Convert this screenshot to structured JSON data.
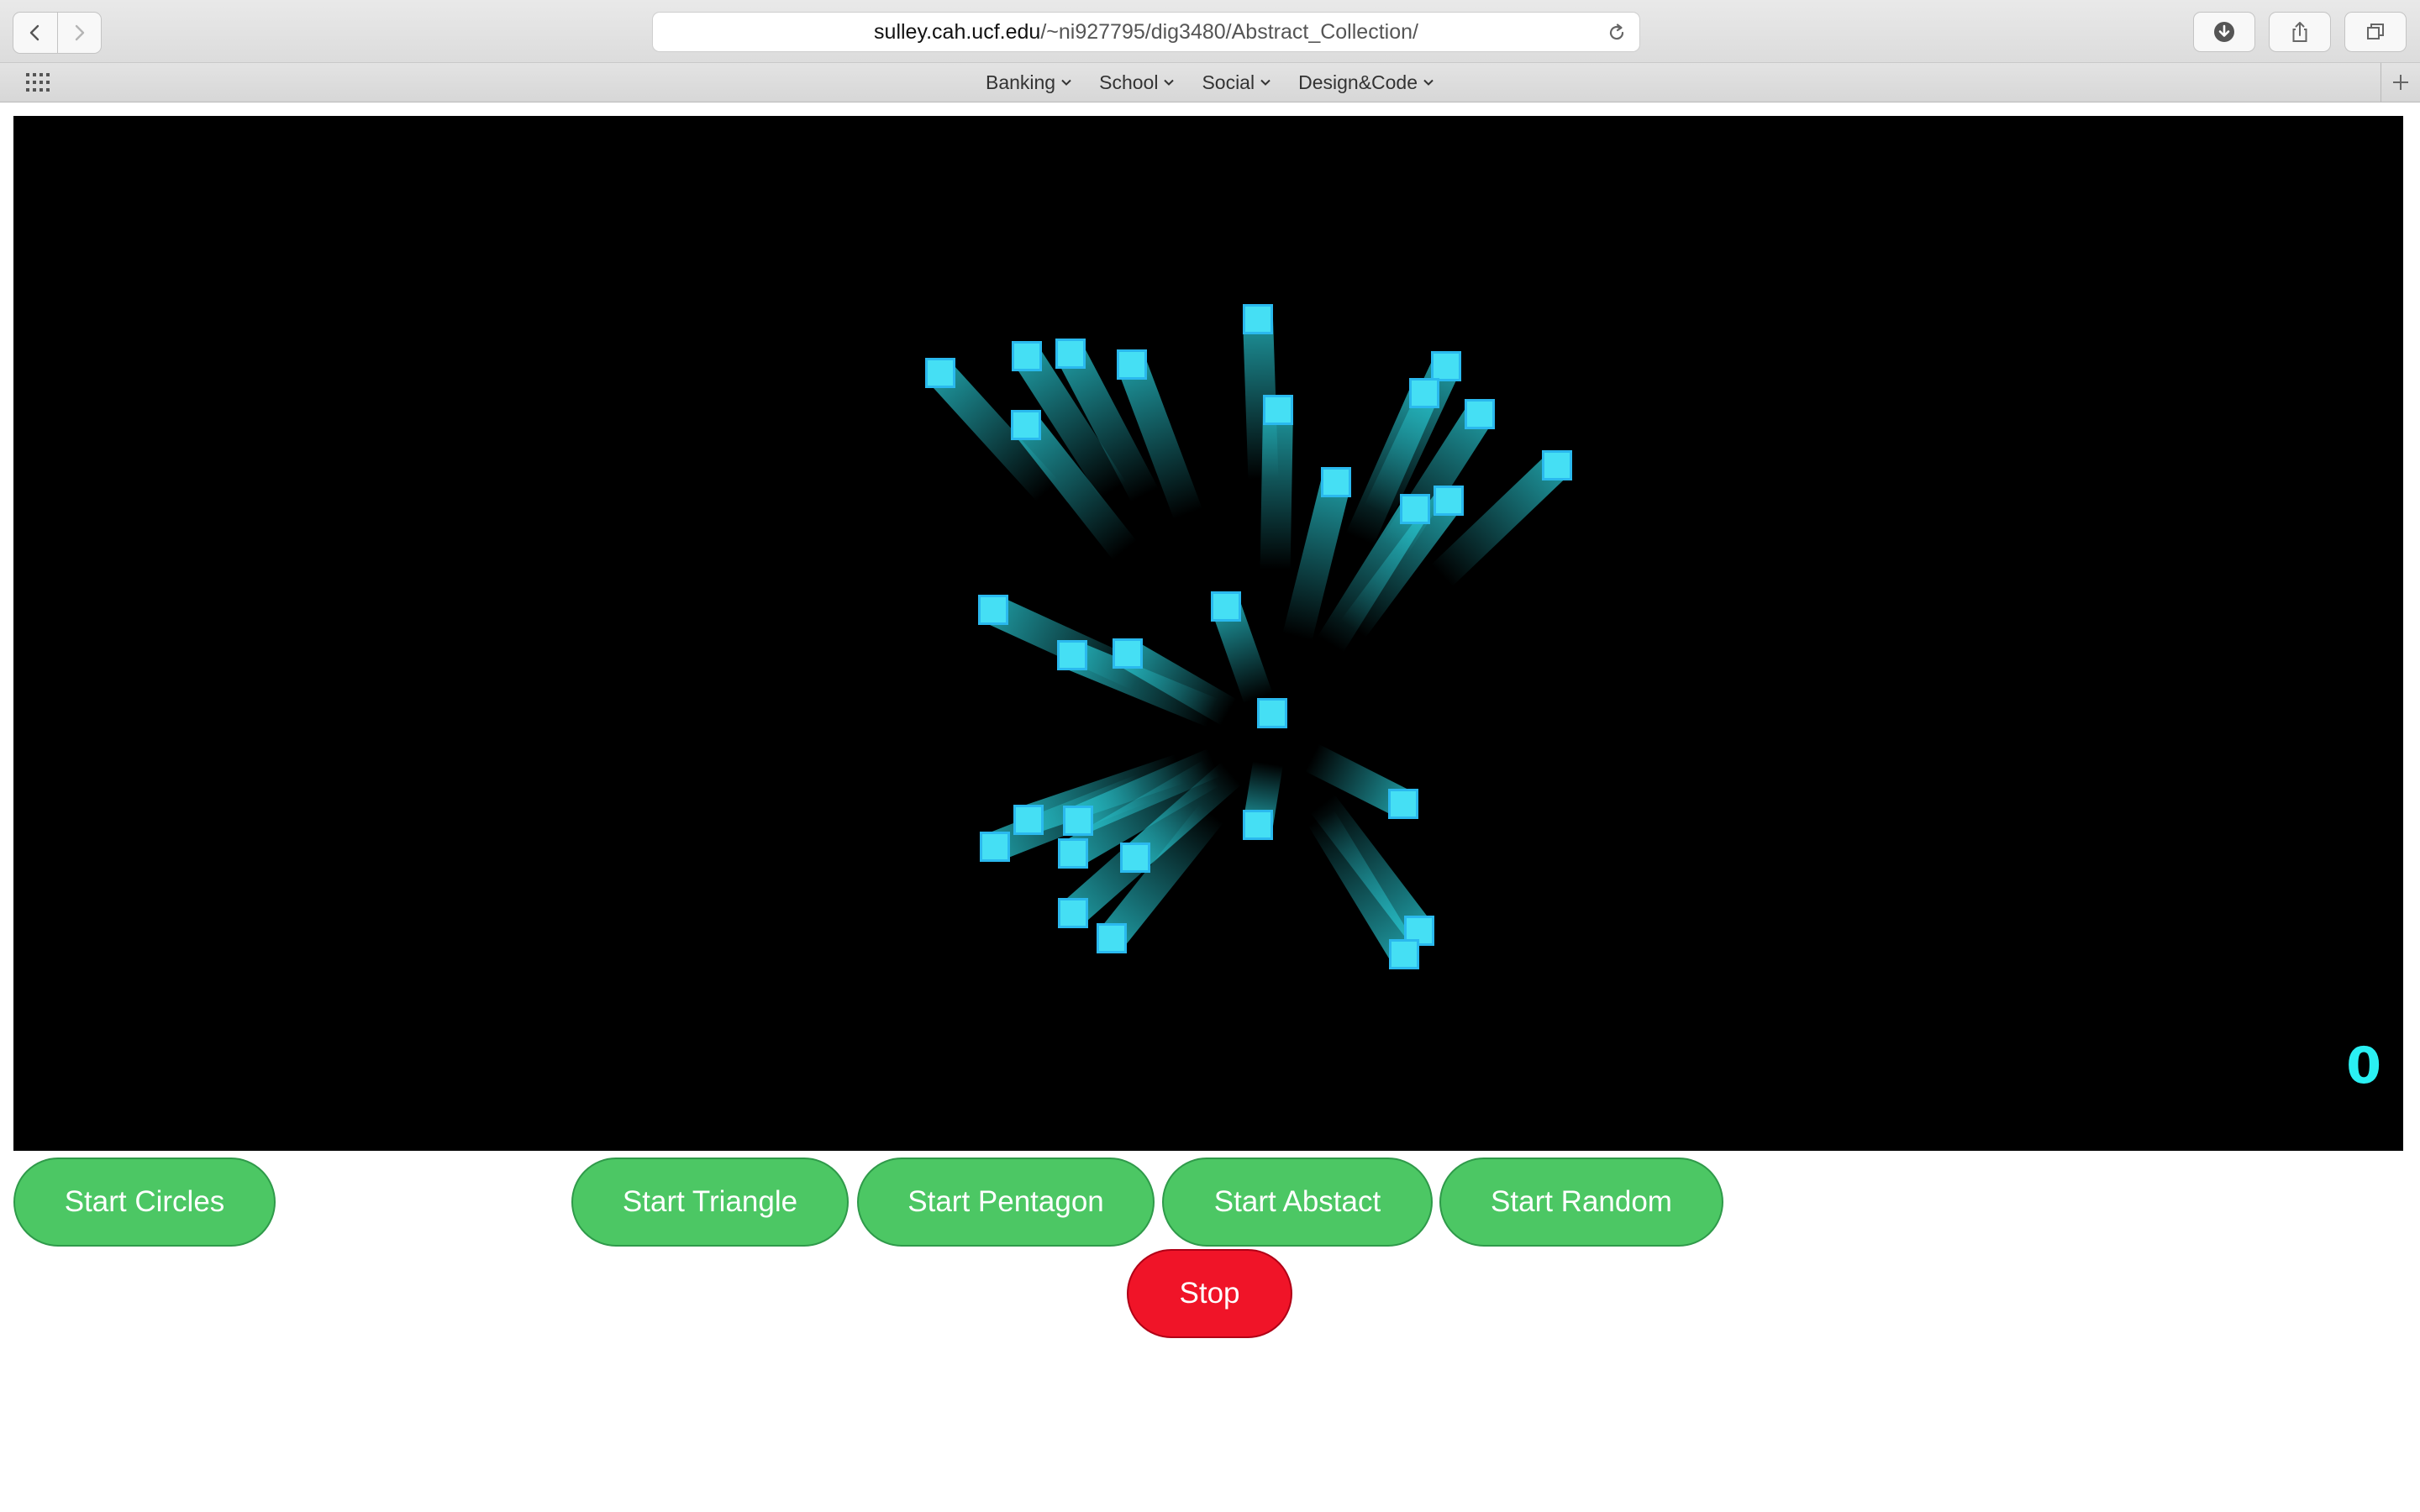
{
  "browser": {
    "url_host": "sulley.cah.ucf.edu",
    "url_path": "/~ni927795/dig3480/Abstract_Collection/",
    "favorites": [
      {
        "label": "Banking"
      },
      {
        "label": "School"
      },
      {
        "label": "Social"
      },
      {
        "label": "Design&Code"
      }
    ],
    "icons": {
      "back": "chevron-left-icon",
      "forward": "chevron-right-icon",
      "reload": "reload-icon",
      "download": "download-icon",
      "share": "share-icon",
      "tabs": "tabs-icon",
      "apps": "grid-icon",
      "new_tab": "plus-icon"
    }
  },
  "canvas": {
    "background": "#000000",
    "particle_color": "#45dff4",
    "score": "0"
  },
  "controls": {
    "start_circles": "Start Circles",
    "start_triangle": "Start Triangle",
    "start_pentagon": "Start Pentagon",
    "start_abstract": "Start Abstact",
    "start_random": "Start Random",
    "stop": "Stop"
  },
  "colors": {
    "start_button": "#4cc764",
    "stop_button": "#f01428",
    "score_text": "#2af0f3"
  }
}
